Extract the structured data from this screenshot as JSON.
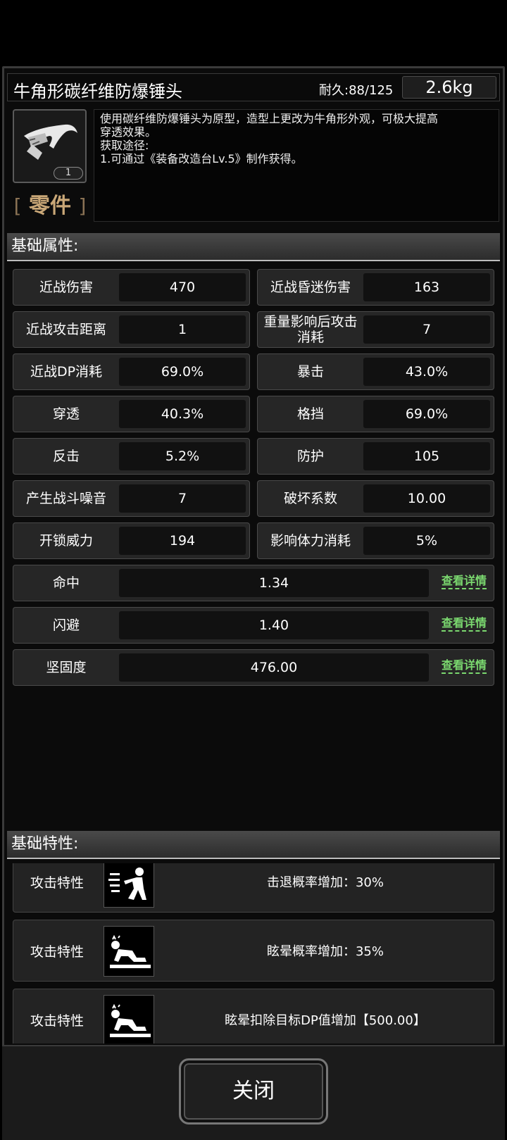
{
  "item": {
    "name": "牛角形碳纤维防爆锤头",
    "durability": "耐久:88/125",
    "weight": "2.6kg",
    "count": "1",
    "category": "零件",
    "category_left": "[",
    "category_right": "]",
    "description": [
      "使用碳纤维防爆锤头为原型，造型上更改为牛角形外观，可极大提高",
      "穿透效果。",
      "获取途径:",
      "1.可通过《装备改造台Lv.5》制作获得。"
    ]
  },
  "sections": {
    "basic_attributes": "基础属性:",
    "basic_traits": "基础特性:"
  },
  "stats": [
    {
      "label": "近战伤害",
      "value": "470"
    },
    {
      "label": "近战昏迷伤害",
      "value": "163"
    },
    {
      "label": "近战攻击距离",
      "value": "1"
    },
    {
      "label": "重量影响后攻击消耗",
      "value": "7"
    },
    {
      "label": "近战DP消耗",
      "value": "69.0%"
    },
    {
      "label": "暴击",
      "value": "43.0%"
    },
    {
      "label": "穿透",
      "value": "40.3%"
    },
    {
      "label": "格挡",
      "value": "69.0%"
    },
    {
      "label": "反击",
      "value": "5.2%"
    },
    {
      "label": "防护",
      "value": "105"
    },
    {
      "label": "产生战斗噪音",
      "value": "7"
    },
    {
      "label": "破坏系数",
      "value": "10.00"
    },
    {
      "label": "开锁威力",
      "value": "194"
    },
    {
      "label": "影响体力消耗",
      "value": "5%"
    }
  ],
  "wide_stats": [
    {
      "label": "命中",
      "value": "1.34",
      "link": "查看详情"
    },
    {
      "label": "闪避",
      "value": "1.40",
      "link": "查看详情"
    },
    {
      "label": "坚固度",
      "value": "476.00",
      "link": "查看详情"
    }
  ],
  "traits": [
    {
      "type": "攻击特性",
      "icon": "knockback-icon",
      "desc": "击退概率增加：30%"
    },
    {
      "type": "攻击特性",
      "icon": "stun-icon",
      "desc": "眩晕概率增加：35%"
    },
    {
      "type": "攻击特性",
      "icon": "stun-icon",
      "desc": "眩晕扣除目标DP值增加【500.00】"
    }
  ],
  "footer": {
    "close_label": "关闭"
  },
  "colors": {
    "link_green": "#7bd86f",
    "category_gold": "#c9a777"
  }
}
